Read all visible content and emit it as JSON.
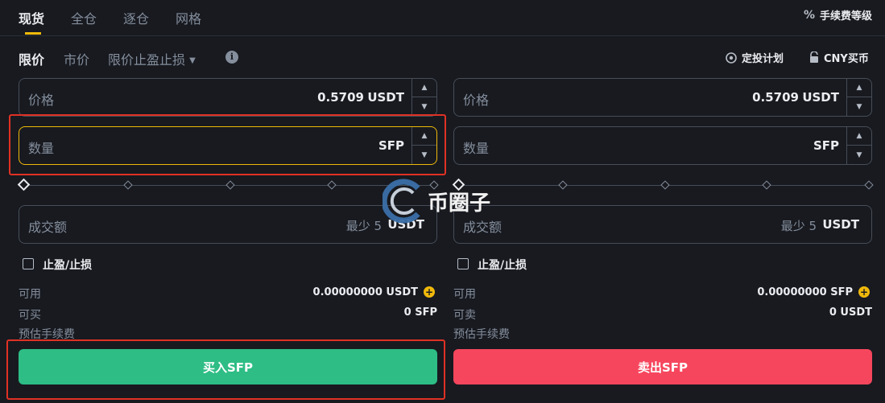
{
  "tabs": [
    {
      "label": "现货",
      "active": true
    },
    {
      "label": "全仓",
      "active": false
    },
    {
      "label": "逐仓",
      "active": false
    },
    {
      "label": "网格",
      "active": false
    }
  ],
  "fee_tier": {
    "label": "手续费等级",
    "icon": "percent-icon"
  },
  "order_types": [
    {
      "label": "限价",
      "active": true
    },
    {
      "label": "市价",
      "active": false
    },
    {
      "label": "限价止盈止损",
      "active": false,
      "dropdown": true
    }
  ],
  "top_links": {
    "auto_invest": "定投计划",
    "buy_cny": "CNY买币"
  },
  "buy": {
    "price_label": "价格",
    "price_value": "0.5709",
    "price_unit": "USDT",
    "amount_label": "数量",
    "amount_unit": "SFP",
    "total_label": "成交额",
    "total_hint": "最少 5",
    "total_unit": "USDT",
    "tpsl_label": "止盈/止损",
    "available_label": "可用",
    "available_value": "0.00000000 USDT",
    "max_label": "可买",
    "max_value": "0 SFP",
    "fee_label": "预估手续费",
    "button_label": "买入SFP"
  },
  "sell": {
    "price_label": "价格",
    "price_value": "0.5709",
    "price_unit": "USDT",
    "amount_label": "数量",
    "amount_unit": "SFP",
    "total_label": "成交额",
    "total_hint": "最少 5",
    "total_unit": "USDT",
    "tpsl_label": "止盈/止损",
    "available_label": "可用",
    "available_value": "0.00000000 SFP",
    "max_label": "可卖",
    "max_value": "0 USDT",
    "fee_label": "预估手续费",
    "button_label": "卖出SFP"
  },
  "watermark": {
    "text": "币圈子"
  },
  "colors": {
    "background": "#181a20",
    "accent": "#f0b90b",
    "buy": "#2ebd85",
    "sell": "#f6465d",
    "highlight_box": "#e03124"
  }
}
